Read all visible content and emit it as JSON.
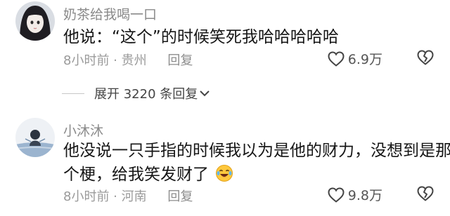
{
  "comments": [
    {
      "username": "奶茶给我喝一口",
      "text_lines": [
        "他说：“这个”的时候笑死我哈哈哈哈哈"
      ],
      "time": "8小时前",
      "location": "贵州",
      "reply_label": "回复",
      "likes": "6.9万"
    },
    {
      "username": "小沐沐",
      "text_lines": [
        "他没说一只手指的时候我以为是他的财力，没想到是那",
        "个梗，给我笑发财了"
      ],
      "time": "8小时前",
      "location": "河南",
      "reply_label": "回复",
      "likes": "9.8万"
    }
  ],
  "expand_replies": {
    "label": "展开 3220 条回复"
  },
  "icons": {
    "like": "heart-outline-icon",
    "dislike": "broken-heart-icon",
    "expand": "chevron-down-icon",
    "emoji": "crying-laughing-emoji-icon"
  },
  "colors": {
    "text": "#161616",
    "secondary": "#9a9a9a",
    "background": "#ffffff"
  }
}
